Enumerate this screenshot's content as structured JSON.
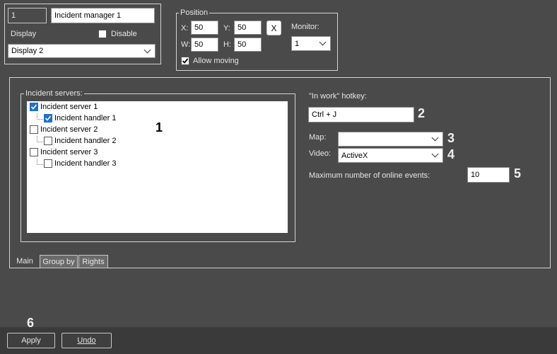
{
  "top_left": {
    "id_value": "1",
    "name_value": "Incident manager 1",
    "display_label": "Display",
    "disable_label": "Disable",
    "display_selected": "Display 2"
  },
  "position": {
    "legend": "Position",
    "x_label": "X:",
    "x_value": "50",
    "y_label": "Y:",
    "y_value": "50",
    "w_label": "W:",
    "w_value": "50",
    "h_label": "H:",
    "h_value": "50",
    "reset_label": "X",
    "monitor_label": "Monitor:",
    "monitor_selected": "1",
    "allow_moving_label": "Allow moving",
    "allow_moving_checked": true
  },
  "incident_servers": {
    "legend": "Incident servers:",
    "items": [
      {
        "label": "Incident server 1",
        "checked": true,
        "level": 0
      },
      {
        "label": "Incident handler 1",
        "checked": true,
        "level": 1
      },
      {
        "label": "Incident server 2",
        "checked": false,
        "level": 0
      },
      {
        "label": "Incident handler 2",
        "checked": false,
        "level": 1
      },
      {
        "label": "Incident server 3",
        "checked": false,
        "level": 0
      },
      {
        "label": "Incident handler 3",
        "checked": false,
        "level": 1
      }
    ]
  },
  "settings": {
    "hotkey_label": "\"In work\" hotkey:",
    "hotkey_value": "Ctrl + J",
    "map_label": "Map:",
    "map_selected": "",
    "video_label": "Video:",
    "video_selected": "ActiveX",
    "max_events_label": "Maximum number of online events:",
    "max_events_value": "10"
  },
  "callouts": [
    "1",
    "2",
    "3",
    "4",
    "5",
    "6"
  ],
  "tabs": [
    {
      "label": "Main",
      "active": true
    },
    {
      "label": "Group by",
      "active": false
    },
    {
      "label": "Rights",
      "active": false
    }
  ],
  "buttons": {
    "apply": "Apply",
    "undo": "Undo"
  },
  "colors": {
    "background": "#4a4a4a",
    "check_accent": "#1e6fd0",
    "bottom_bar": "#3a3a3a"
  }
}
